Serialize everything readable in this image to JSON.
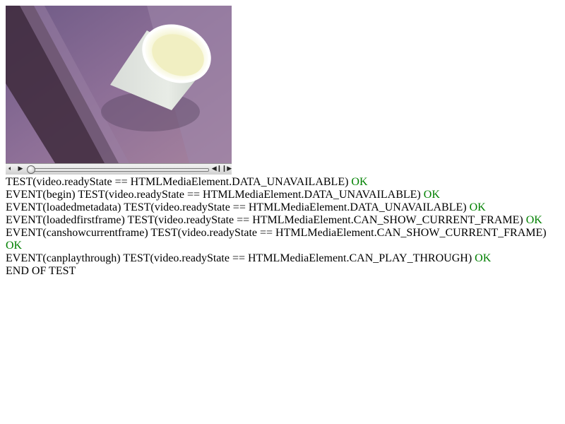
{
  "video": {
    "controls": {
      "volume_icon": "speaker-icon",
      "play_icon": "play-icon",
      "seek_back_icon": "seek-back-icon",
      "seek_forward_icon": "seek-forward-icon",
      "progress": 0.0
    }
  },
  "log": {
    "lines": [
      {
        "text": "TEST(video.readyState == HTMLMediaElement.DATA_UNAVAILABLE) ",
        "status": "OK"
      },
      {
        "text": "EVENT(begin) TEST(video.readyState == HTMLMediaElement.DATA_UNAVAILABLE) ",
        "status": "OK"
      },
      {
        "text": "EVENT(loadedmetadata) TEST(video.readyState == HTMLMediaElement.DATA_UNAVAILABLE) ",
        "status": "OK"
      },
      {
        "text": "EVENT(loadedfirstframe) TEST(video.readyState == HTMLMediaElement.CAN_SHOW_CURRENT_FRAME) ",
        "status": "OK"
      },
      {
        "text": "EVENT(canshowcurrentframe) TEST(video.readyState == HTMLMediaElement.CAN_SHOW_CURRENT_FRAME) ",
        "status": "OK"
      },
      {
        "text": "EVENT(canplaythrough) TEST(video.readyState == HTMLMediaElement.CAN_PLAY_THROUGH) ",
        "status": "OK"
      }
    ],
    "end": "END OF TEST"
  },
  "colors": {
    "ok": "#008000"
  }
}
